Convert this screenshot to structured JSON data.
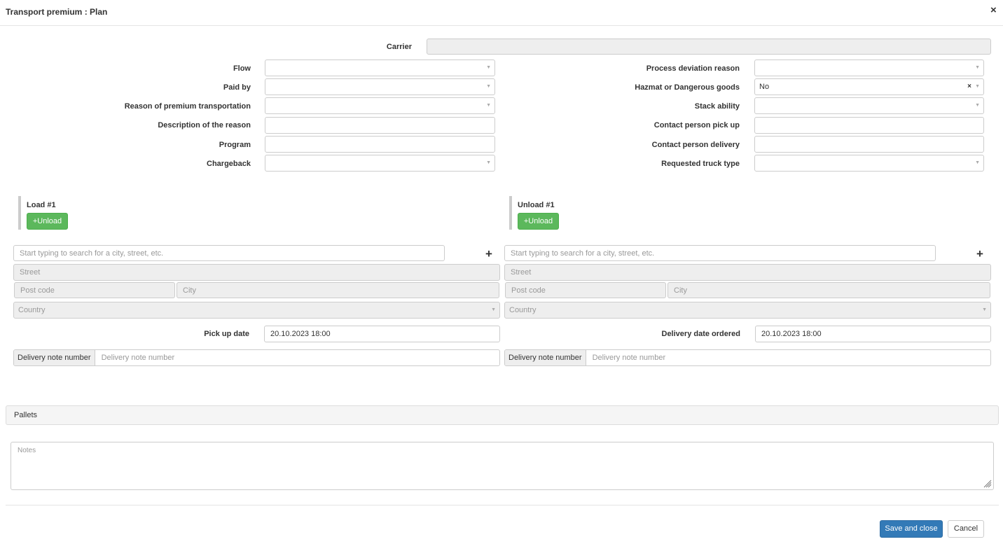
{
  "dialog": {
    "title": "Transport premium : Plan",
    "close_icon": "×"
  },
  "carrier": {
    "label": "Carrier",
    "value": ""
  },
  "left_fields": {
    "flow": {
      "label": "Flow",
      "value": ""
    },
    "paid_by": {
      "label": "Paid by",
      "value": ""
    },
    "reason": {
      "label": "Reason of premium transportation",
      "value": ""
    },
    "description": {
      "label": "Description of the reason",
      "value": ""
    },
    "program": {
      "label": "Program",
      "value": ""
    },
    "chargeback": {
      "label": "Chargeback",
      "value": ""
    }
  },
  "right_fields": {
    "process_deviation": {
      "label": "Process deviation reason",
      "value": ""
    },
    "hazmat": {
      "label": "Hazmat or Dangerous goods",
      "value": "No",
      "clear_icon": "×"
    },
    "stack_ability": {
      "label": "Stack ability",
      "value": ""
    },
    "contact_pickup": {
      "label": "Contact person pick up",
      "value": ""
    },
    "contact_delivery": {
      "label": "Contact person delivery",
      "value": ""
    },
    "truck_type": {
      "label": "Requested truck type",
      "value": ""
    }
  },
  "load": {
    "title": "Load #1",
    "unload_button": "+Unload",
    "search_placeholder": "Start typing to search for a city, street, etc.",
    "add_icon": "+",
    "street_placeholder": "Street",
    "postcode_placeholder": "Post code",
    "city_placeholder": "City",
    "country_placeholder": "Country",
    "date_label": "Pick up date",
    "date_value": "20.10.2023 18:00",
    "delivery_note_addon": "Delivery note number",
    "delivery_note_placeholder": "Delivery note number"
  },
  "unload": {
    "title": "Unload #1",
    "unload_button": "+Unload",
    "search_placeholder": "Start typing to search for a city, street, etc.",
    "add_icon": "+",
    "street_placeholder": "Street",
    "postcode_placeholder": "Post code",
    "city_placeholder": "City",
    "country_placeholder": "Country",
    "date_label": "Delivery date ordered",
    "date_value": "20.10.2023 18:00",
    "delivery_note_addon": "Delivery note number",
    "delivery_note_placeholder": "Delivery note number"
  },
  "pallets": {
    "title": "Pallets"
  },
  "notes": {
    "placeholder": "Notes"
  },
  "footer": {
    "save_label": "Save and close",
    "cancel_label": "Cancel"
  },
  "colors": {
    "primary": "#337ab7",
    "success": "#5cb85c",
    "disabled_bg": "#eeeeee",
    "panel_bg": "#f5f5f5"
  }
}
